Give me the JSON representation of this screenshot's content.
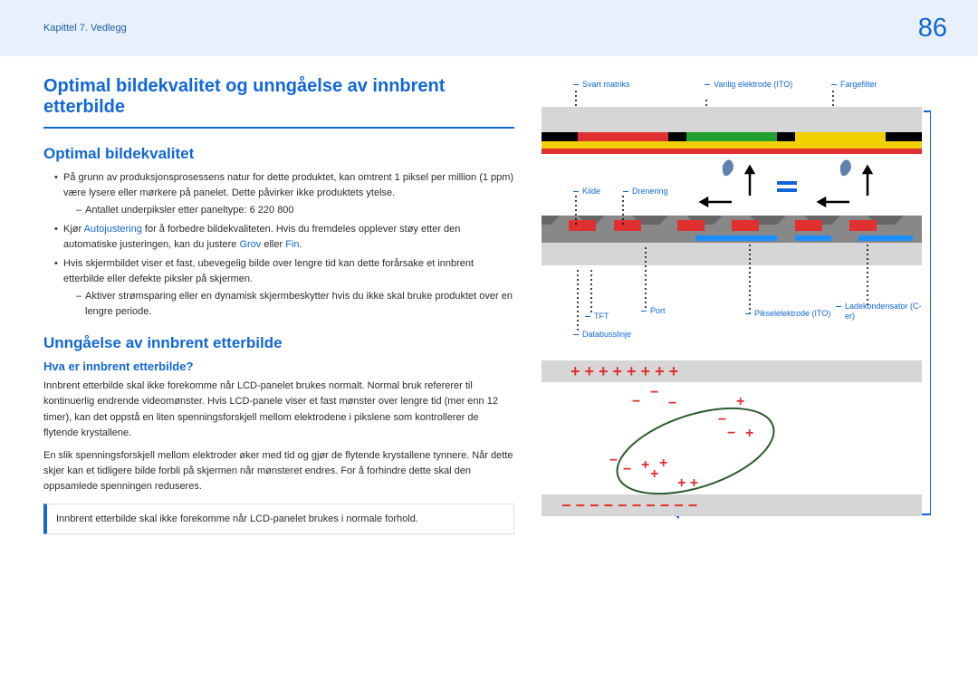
{
  "header": {
    "chapter": "Kapittel 7. Vedlegg",
    "page": "86"
  },
  "main_title": "Optimal bildekvalitet og unngåelse av innbrent etterbilde",
  "section1": {
    "title": "Optimal bildekvalitet",
    "b1_pre": "På grunn av produksjonsprosessens natur for dette produktet, kan omtrent 1 piksel per million (1 ppm) være lysere eller mørkere på panelet. Dette påvirker ikke produktets ytelse.",
    "b1_sub": "Antallet underpiksler etter paneltype: 6 220 800",
    "b2_pre": "Kjør ",
    "b2_hl1": "Autojustering",
    "b2_mid": " for å forbedre bildekvaliteten. Hvis du fremdeles opplever støy etter den automatiske justeringen, kan du justere ",
    "b2_hl2": "Grov",
    "b2_join": " eller ",
    "b2_hl3": "Fin",
    "b2_end": ".",
    "b3": "Hvis skjermbildet viser et fast, ubevegelig bilde over lengre tid kan dette forårsake et innbrent etterbilde eller defekte piksler på skjermen.",
    "b3_sub": "Aktiver strømsparing eller en dynamisk skjermbeskytter hvis du ikke skal bruke produktet over en lengre periode."
  },
  "section2": {
    "title": "Unngåelse av innbrent etterbilde",
    "sub_title": "Hva er innbrent etterbilde?",
    "p1": "Innbrent etterbilde skal ikke forekomme når LCD-panelet brukes normalt. Normal bruk refererer til kontinuerlig endrende videomønster. Hvis LCD-panele viser et fast mønster over lengre tid (mer enn 12 timer), kan det oppstå en liten spenningsforskjell mellom elektrodene i pikslene som kontrollerer de flytende krystallene.",
    "p2": "En slik spenningsforskjell mellom elektroder øker med tid og gjør de flytende krystallene tynnere. Når dette skjer kan et tidligere bilde forbli på skjermen når mønsteret endres. For å forhindre dette skal den oppsamlede spenningen reduseres.",
    "note": "Innbrent etterbilde skal ikke forekomme når LCD-panelet brukes i normale forhold."
  },
  "labels": {
    "svart_matriks": "Svart matriks",
    "vanlig_elektrode": "Vanlig elektrode (ITO)",
    "fargefilter": "Fargefilter",
    "kilde": "Kilde",
    "drenering": "Drenering",
    "tft": "TFT",
    "port": "Port",
    "databusslinje": "Databusslinje",
    "pikselelektrode": "Pikselelektrode (ITO)",
    "ladekondensator": "Ladekondensator (C-er)"
  },
  "chart_data": {
    "type": "diagram",
    "description": "Cross-section of LCD pixel structure showing labeled layers (black matrix, common electrode ITO, color filter, source, drain, TFT, gate, data bus line, pixel electrode ITO, storage capacitor) and illustration of charge buildup on liquid crystal layer with + and − signs."
  }
}
